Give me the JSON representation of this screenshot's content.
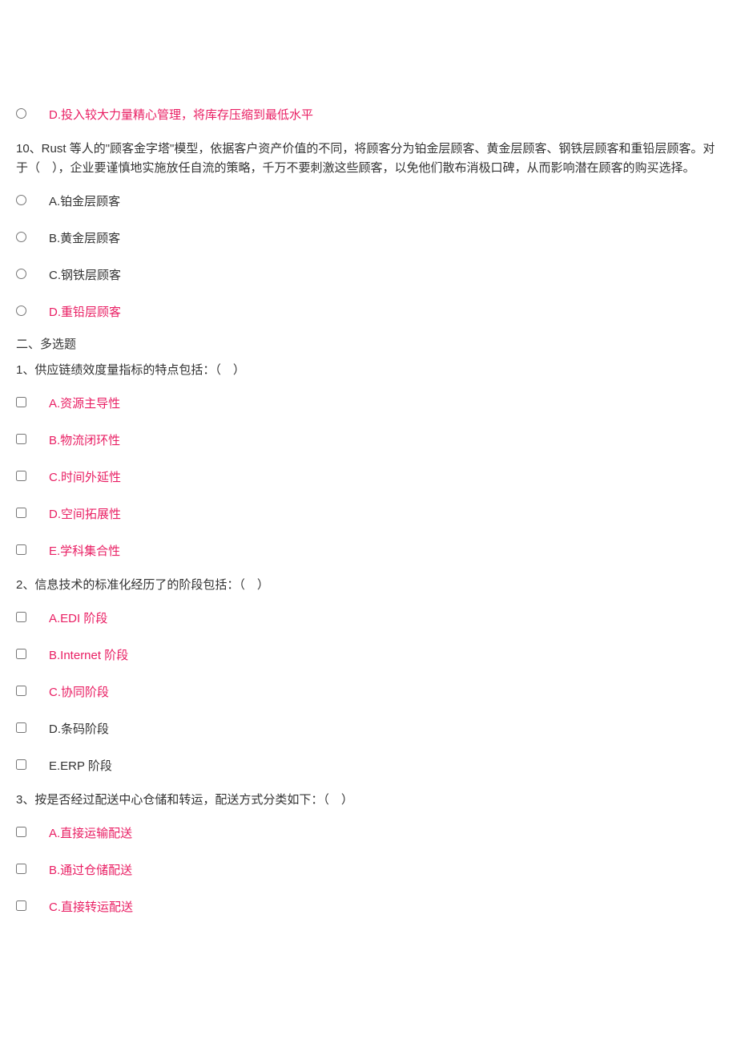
{
  "q9": {
    "optD": "D.投入较大力量精心管理，将库存压缩到最低水平"
  },
  "q10": {
    "text": "10、Rust 等人的\"顾客金字塔\"模型，依据客户资产价值的不同，将顾客分为铂金层顾客、黄金层顾客、钢铁层顾客和重铅层顾客。对于（　），企业要谨慎地实施放任自流的策略，千万不要刺激这些顾客，以免他们散布消极口碑，从而影响潜在顾客的购买选择。",
    "optA": "A.铂金层顾客",
    "optB": "B.黄金层顾客",
    "optC": "C.钢铁层顾客",
    "optD": "D.重铅层顾客"
  },
  "section2": {
    "title": "二、多选题"
  },
  "mq1": {
    "text": "1、供应链绩效度量指标的特点包括：（　）",
    "optA": "A.资源主导性",
    "optB": "B.物流闭环性",
    "optC": "C.时间外延性",
    "optD": "D.空间拓展性",
    "optE": "E.学科集合性"
  },
  "mq2": {
    "text": "2、信息技术的标准化经历了的阶段包括：（　）",
    "optA": "A.EDI 阶段",
    "optB": "B.Internet 阶段",
    "optC": "C.协同阶段",
    "optD": "D.条码阶段",
    "optE": "E.ERP 阶段"
  },
  "mq3": {
    "text": "3、按是否经过配送中心仓储和转运，配送方式分类如下：（　）",
    "optA": "A.直接运输配送",
    "optB": "B.通过仓储配送",
    "optC": "C.直接转运配送"
  }
}
